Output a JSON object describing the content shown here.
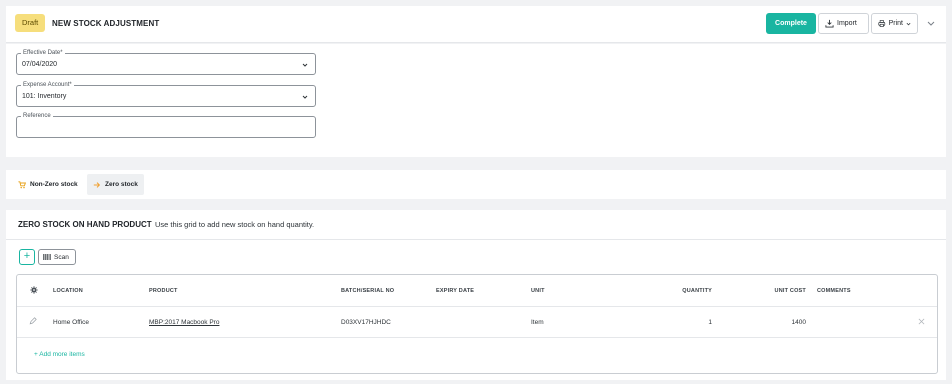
{
  "header": {
    "status_badge": "Draft",
    "title": "NEW STOCK ADJUSTMENT",
    "complete_label": "Complete",
    "import_label": "Import",
    "print_label": "Print"
  },
  "form": {
    "effective_date": {
      "label": "Effective Date*",
      "value": "07/04/2020"
    },
    "expense_account": {
      "label": "Expense Account*",
      "value": "101: Inventory"
    },
    "reference": {
      "label": "Reference",
      "value": ""
    }
  },
  "tabs": [
    {
      "label": "Non-Zero stock",
      "icon": "cart-icon",
      "active": false
    },
    {
      "label": "Zero stock",
      "icon": "arrow-right-icon",
      "active": true
    }
  ],
  "grid": {
    "title": "ZERO STOCK ON HAND PRODUCT",
    "subtitle": "Use this grid to add new stock on hand quantity.",
    "scan_label": "Scan",
    "add_more_label": "+ Add more items",
    "columns": [
      "LOCATION",
      "PRODUCT",
      "BATCH/SERIAL NO",
      "EXPIRY DATE",
      "UNIT",
      "QUANTITY",
      "UNIT COST",
      "COMMENTS"
    ],
    "rows": [
      {
        "location": "Home Office",
        "product": "MBP:2017 Macbook Pro",
        "batch": "D03XV17HJHDC",
        "expiry": "",
        "unit": "Item",
        "quantity": "1",
        "unit_cost": "1400",
        "comments": ""
      }
    ]
  },
  "colors": {
    "accent": "#19b5a1",
    "badge": "#f6de7c",
    "tab_icon_cart": "#e8a21a",
    "tab_icon_arrow": "#f0a030"
  }
}
